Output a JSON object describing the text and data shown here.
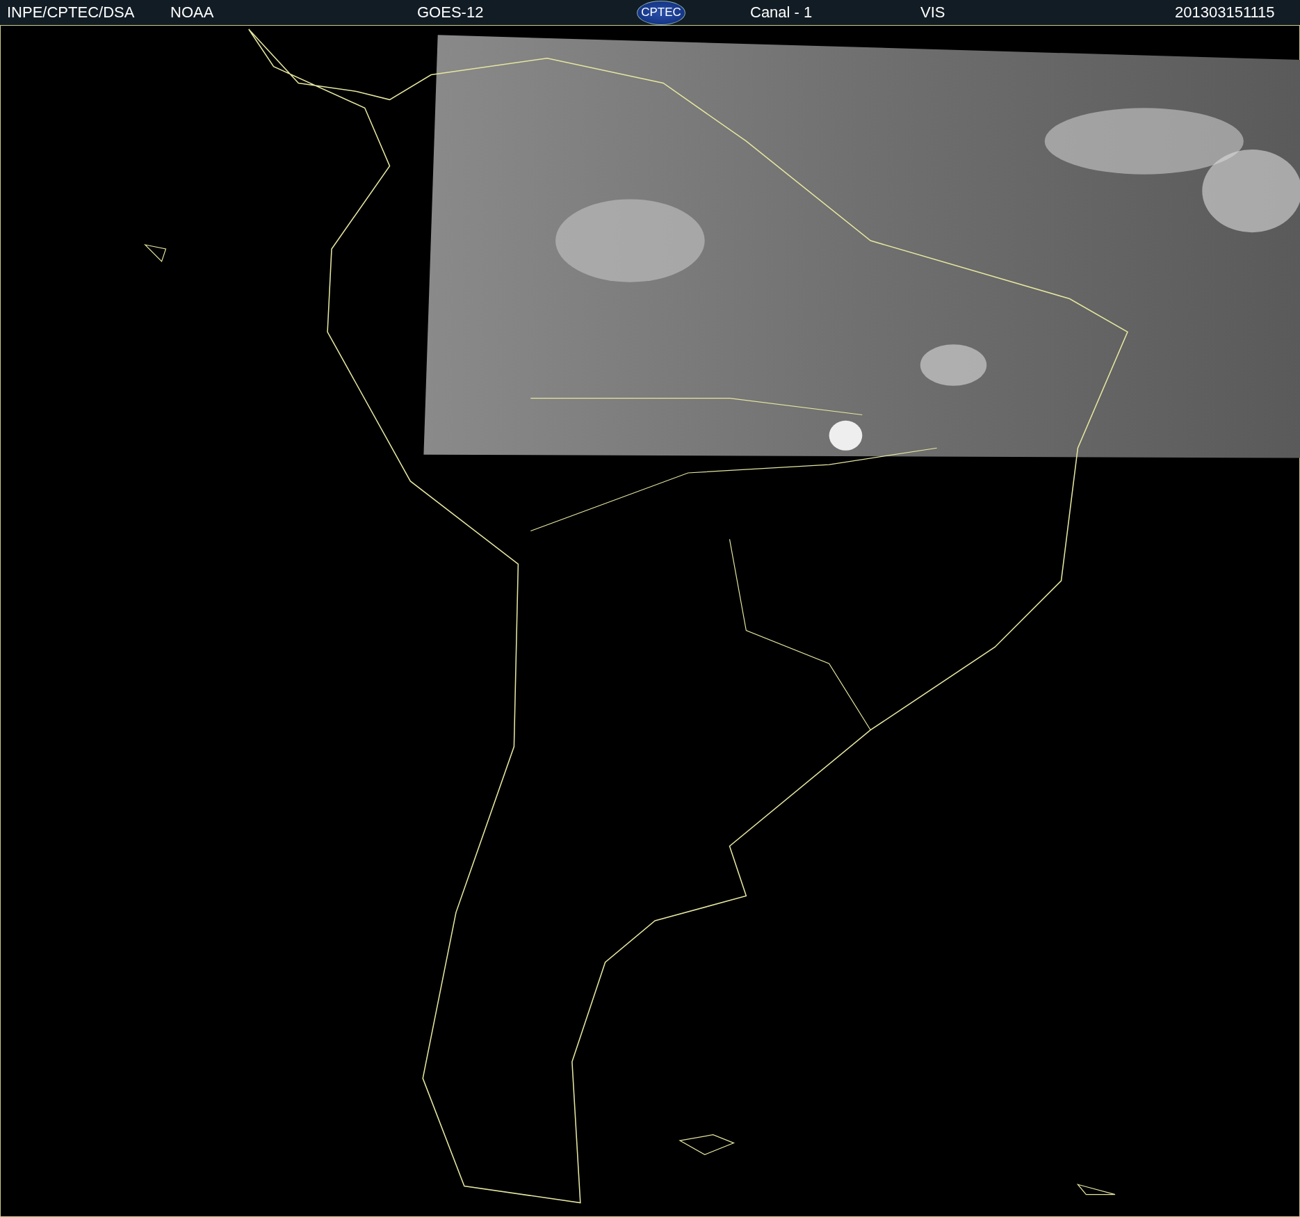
{
  "header": {
    "items": [
      {
        "kind": "text",
        "text": "INPE/CPTEC/DSA"
      },
      {
        "kind": "text",
        "text": "NOAA"
      },
      {
        "kind": "text",
        "text": "GOES-12"
      },
      {
        "kind": "logo",
        "text": "CPTEC"
      },
      {
        "kind": "text",
        "text": "Canal - 1"
      },
      {
        "kind": "text",
        "text": "VIS"
      },
      {
        "kind": "text",
        "text": "201303151115"
      }
    ]
  }
}
